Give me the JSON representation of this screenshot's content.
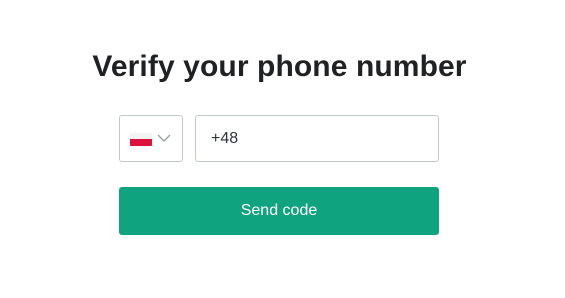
{
  "heading": {
    "title": "Verify your phone number"
  },
  "phone": {
    "country_flag": "flag-poland-icon",
    "dropdown_icon": "chevron-down-icon",
    "value": "+48"
  },
  "actions": {
    "send_label": "Send code"
  },
  "colors": {
    "accent": "#10a37f",
    "border": "#c2c8d0",
    "title": "#202123"
  }
}
